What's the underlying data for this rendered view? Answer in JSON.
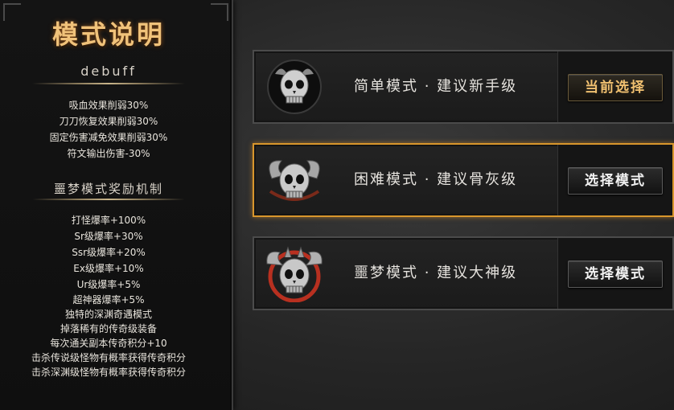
{
  "left_panel": {
    "title": "模式说明",
    "debuff_heading": "debuff",
    "debuff_items": [
      "吸血效果削弱30%",
      "刀刀恢复效果削弱30%",
      "固定伤害减免效果削弱30%",
      "符文输出伤害-30%"
    ],
    "reward_heading": "噩梦模式奖励机制",
    "reward_items": [
      "打怪爆率+100%",
      "Sr级爆率+30%",
      "Ssr级爆率+20%",
      "Ex级爆率+10%",
      "Ur级爆率+5%",
      "超神器爆率+5%",
      "独特的深渊奇遇模式",
      "掉落稀有的传奇级装备",
      "每次通关副本传奇积分+10",
      "击杀传说级怪物有概率获得传奇积分",
      "击杀深渊级怪物有概率获得传奇积分"
    ]
  },
  "modes": [
    {
      "label": "简单模式 · 建议新手级",
      "button": "当前选择",
      "state": "current"
    },
    {
      "label": "困难模式 · 建议骨灰级",
      "button": "选择模式",
      "state": "highlighted"
    },
    {
      "label": "噩梦模式 · 建议大神级",
      "button": "选择模式",
      "state": "normal"
    }
  ],
  "colors": {
    "title_gold": "#f0c27a",
    "highlight_border": "#d8962c",
    "current_button_text": "#f0c070",
    "nightmare_red": "#b83020"
  },
  "icons": [
    "skull-easy-icon",
    "skull-horned-icon",
    "skull-nightmare-icon"
  ]
}
